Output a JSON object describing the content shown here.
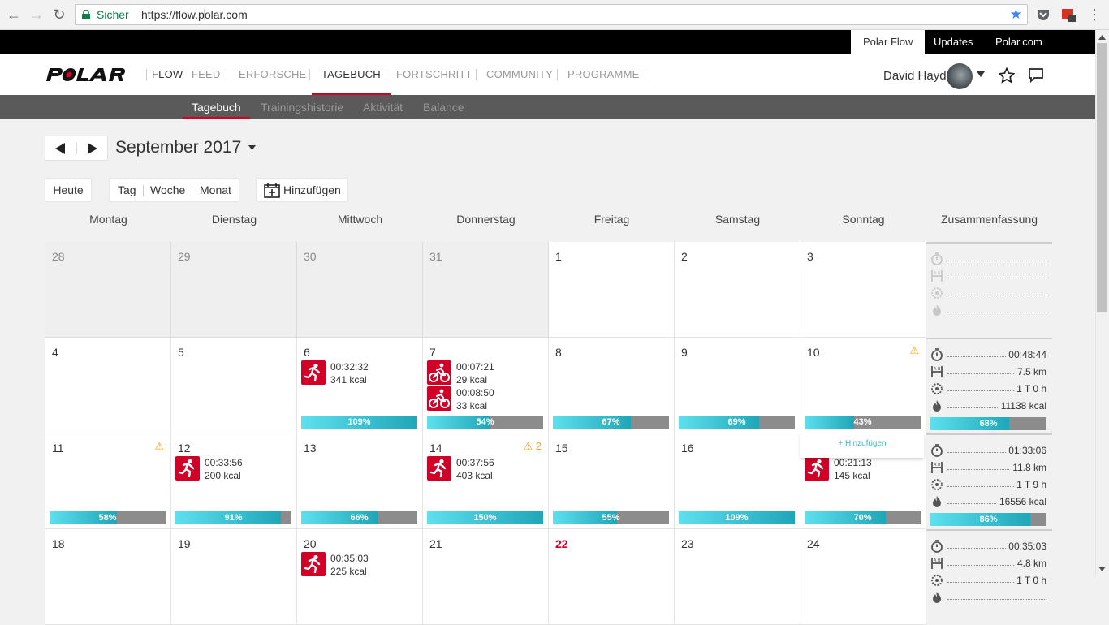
{
  "browser": {
    "secure_label": "Sicher",
    "url": "https://flow.polar.com"
  },
  "topbar": {
    "links": [
      "Polar Flow",
      "Updates",
      "Polar.com"
    ]
  },
  "header": {
    "brand": "FLOW",
    "nav": [
      "FEED",
      "ERFORSCHE",
      "TAGEBUCH",
      "FORTSCHRITT",
      "COMMUNITY",
      "PROGRAMME"
    ],
    "selected_nav": "TAGEBUCH",
    "user_name": "David Haydl"
  },
  "subnav": {
    "items": [
      "Tagebuch",
      "Trainingshistorie",
      "Aktivität",
      "Balance"
    ],
    "selected": "Tagebuch"
  },
  "calendar": {
    "month_label": "September 2017",
    "buttons": {
      "today": "Heute",
      "day": "Tag",
      "week": "Woche",
      "month": "Monat",
      "add": "Hinzufügen"
    },
    "weekdays": [
      "Montag",
      "Dienstag",
      "Mittwoch",
      "Donnerstag",
      "Freitag",
      "Samstag",
      "Sonntag",
      "Zusammenfassung"
    ],
    "weeks": [
      {
        "days": [
          {
            "n": "28",
            "prev": true
          },
          {
            "n": "29",
            "prev": true
          },
          {
            "n": "30",
            "prev": true
          },
          {
            "n": "31",
            "prev": true
          },
          {
            "n": "1"
          },
          {
            "n": "2"
          },
          {
            "n": "3"
          }
        ],
        "summary": {
          "time": "",
          "distance": "",
          "sleep": "",
          "kcal": ""
        }
      },
      {
        "days": [
          {
            "n": "4"
          },
          {
            "n": "5"
          },
          {
            "n": "6",
            "acts": [
              {
                "type": "run",
                "time": "00:32:32",
                "kcal": "341 kcal"
              }
            ],
            "pct": "109%",
            "fill": 1.0
          },
          {
            "n": "7",
            "acts": [
              {
                "type": "bike",
                "time": "00:07:21",
                "kcal": "29 kcal"
              },
              {
                "type": "bike",
                "time": "00:08:50",
                "kcal": "33 kcal"
              }
            ],
            "pct": "54%",
            "fill": 0.54
          },
          {
            "n": "8",
            "pct": "67%",
            "fill": 0.67
          },
          {
            "n": "9",
            "pct": "69%",
            "fill": 0.69
          },
          {
            "n": "10",
            "warn": "⚠",
            "pct": "43%",
            "fill": 0.43
          }
        ],
        "summary": {
          "time": "00:48:44",
          "distance": "7.5 km",
          "sleep": "1 T 0 h",
          "kcal": "11138 kcal",
          "pct": "68%",
          "fill": 0.68
        }
      },
      {
        "days": [
          {
            "n": "11",
            "warn": "⚠",
            "pct": "58%",
            "fill": 0.58
          },
          {
            "n": "12",
            "acts": [
              {
                "type": "run",
                "time": "00:33:56",
                "kcal": "200 kcal"
              }
            ],
            "pct": "91%",
            "fill": 0.91
          },
          {
            "n": "13",
            "pct": "66%",
            "fill": 0.66
          },
          {
            "n": "14",
            "warn": "⚠ 2",
            "acts": [
              {
                "type": "run",
                "time": "00:37:56",
                "kcal": "403 kcal"
              }
            ],
            "pct": "150%",
            "fill": 1.0
          },
          {
            "n": "15",
            "pct": "55%",
            "fill": 0.55
          },
          {
            "n": "16",
            "pct": "109%",
            "fill": 1.0
          },
          {
            "n": "",
            "acts": [
              {
                "type": "run",
                "time": "00:21:13",
                "kcal": "145 kcal"
              }
            ],
            "pct": "70%",
            "fill": 0.7
          }
        ],
        "summary": {
          "time": "01:33:06",
          "distance": "11.8 km",
          "sleep": "1 T 9 h",
          "kcal": "16556 kcal",
          "pct": "86%",
          "fill": 0.86
        }
      },
      {
        "days": [
          {
            "n": "18"
          },
          {
            "n": "19"
          },
          {
            "n": "20",
            "acts": [
              {
                "type": "run",
                "time": "00:35:03",
                "kcal": "225 kcal"
              }
            ]
          },
          {
            "n": "21"
          },
          {
            "n": "22",
            "today": true
          },
          {
            "n": "23"
          },
          {
            "n": "24"
          }
        ],
        "summary": {
          "time": "00:35:03",
          "distance": "4.8 km",
          "sleep": "1 T 0 h",
          "kcal": ""
        }
      }
    ],
    "popup_add": "+ Hinzufügen"
  }
}
